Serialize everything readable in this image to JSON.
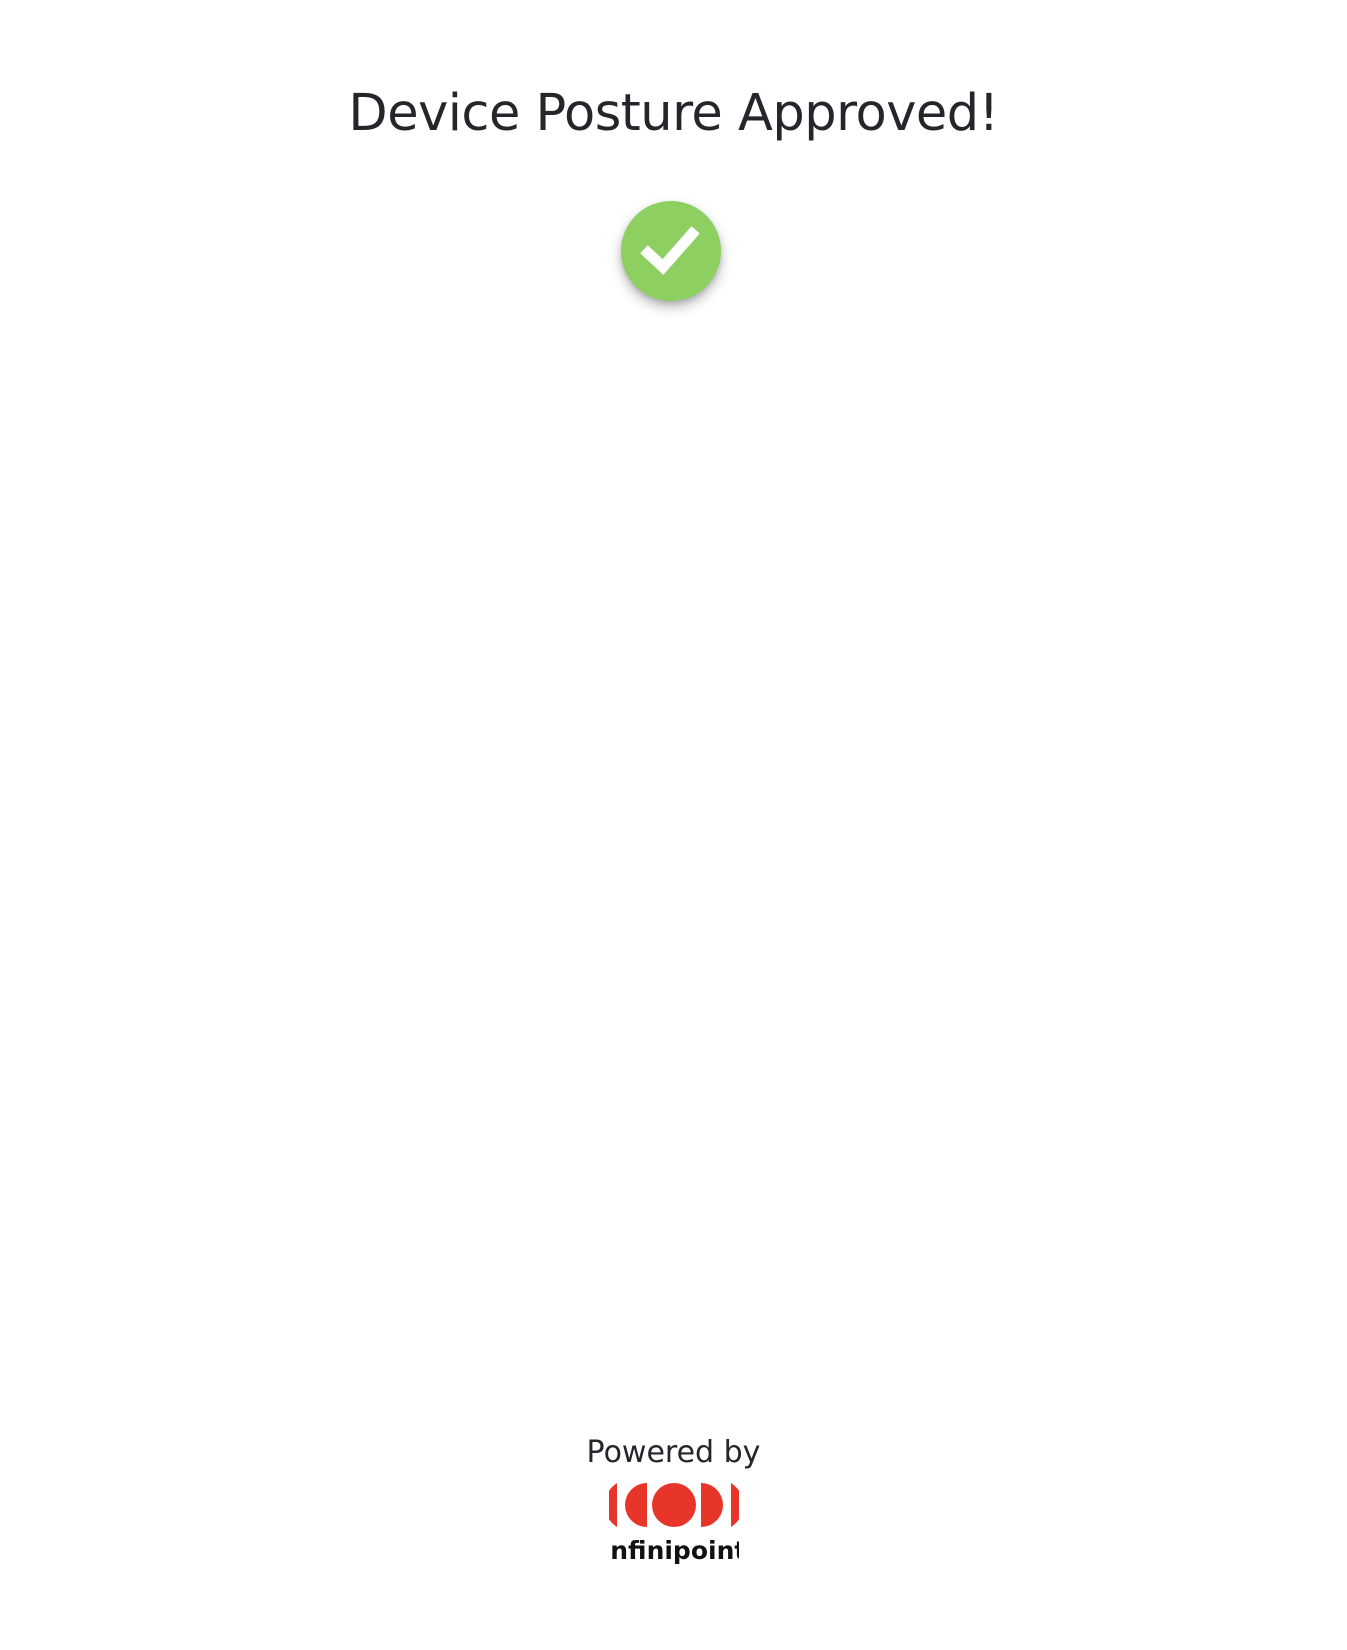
{
  "main": {
    "title": "Device Posture Approved!",
    "status_icon": "check-icon",
    "status_color": "#8ecf62"
  },
  "footer": {
    "powered_by": "Powered by",
    "brand": {
      "name": "infinipoint",
      "logo_icon": "infinipoint-logo",
      "logo_color": "#e8352a",
      "text_color": "#111111"
    }
  }
}
